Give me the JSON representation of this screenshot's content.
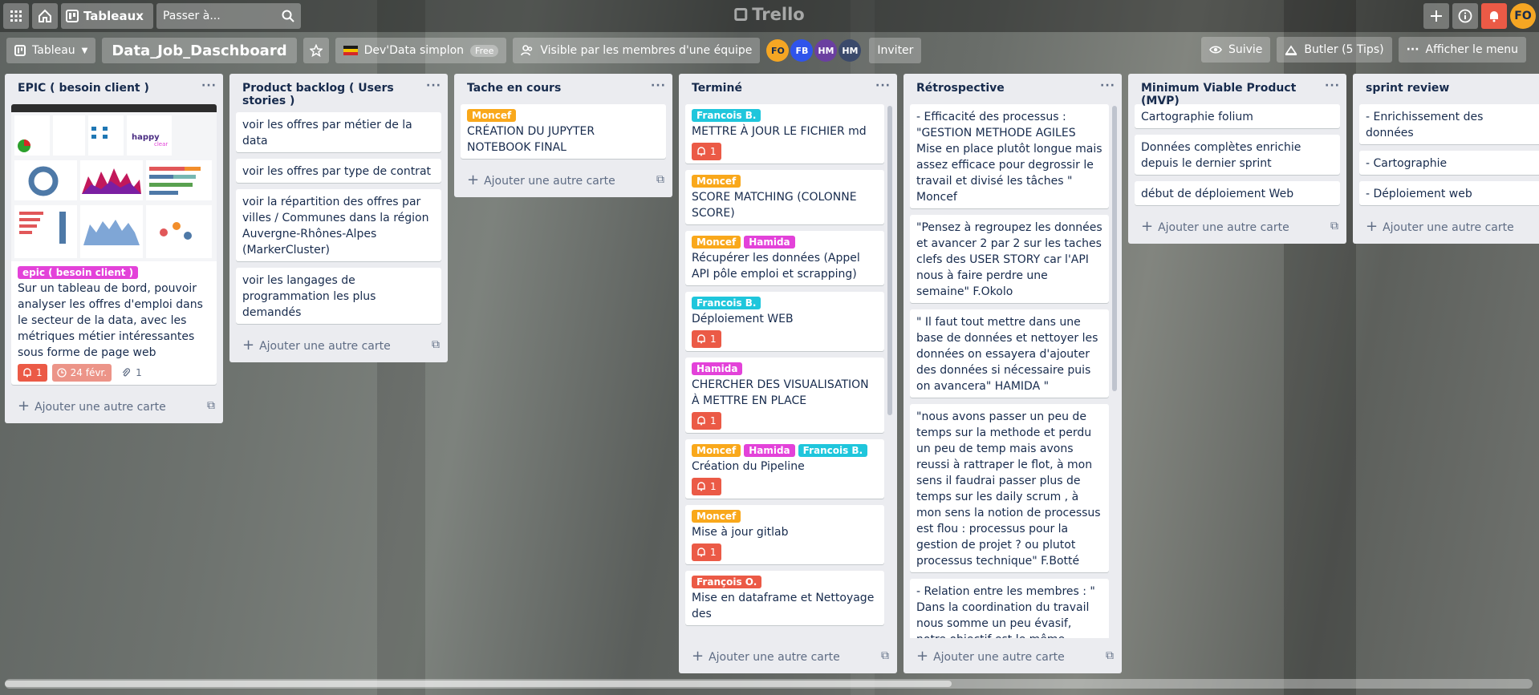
{
  "header": {
    "boards_label": "Tableaux",
    "search_placeholder": "Passer à...",
    "logo": "Trello",
    "user_initials": "FO"
  },
  "board": {
    "view_label": "Tableau",
    "title": "Data_Job_Daschboard",
    "team": "Dev'Data simplon",
    "team_plan": "Free",
    "visibility": "Visible par les membres d'une équipe",
    "members": [
      {
        "initials": "FO",
        "color": "#f5a623"
      },
      {
        "initials": "FB",
        "color": "#2f54eb"
      },
      {
        "initials": "HM",
        "color": "#6b3fa0"
      },
      {
        "initials": "HM",
        "color": "#3b4a6b"
      }
    ],
    "invite": "Inviter",
    "watch": "Suivie",
    "butler": "Butler (5 Tips)",
    "menu": "Afficher le menu"
  },
  "colors": {
    "label_pink": "#e342d9",
    "label_orange": "#f9a81b",
    "label_cyan": "#1fc6dc",
    "label_red": "#eb5a46",
    "badge_red": "#eb5a46"
  },
  "add_card": "Ajouter une autre carte",
  "lists": [
    {
      "title": "EPIC ( besoin client )",
      "cards": [
        {
          "labels": [
            {
              "text": "epic ( besoin client )",
              "color": "#e342d9"
            }
          ],
          "text": "Sur un tableau de bord, pouvoir analyser les offres d'emploi dans le secteur de la data, avec les métriques métier intéressantes sous forme de page web",
          "notif": "1",
          "date": "24 févr.",
          "attach": "1"
        }
      ]
    },
    {
      "title": "Product backlog ( Users stories )",
      "cards": [
        {
          "text": "voir les offres par métier de la data"
        },
        {
          "text": "voir les offres par type de contrat"
        },
        {
          "text": "voir la répartition des offres par villes / Communes dans la région Auvergne-Rhônes-Alpes (MarkerCluster)"
        },
        {
          "text": "voir les langages de programmation les plus demandés"
        }
      ]
    },
    {
      "title": "Tache en cours",
      "cards": [
        {
          "labels": [
            {
              "text": "Moncef",
              "color": "#f9a81b"
            }
          ],
          "text": "CRÉATION DU JUPYTER NOTEBOOK FINAL"
        }
      ]
    },
    {
      "title": "Terminé",
      "cards": [
        {
          "labels": [
            {
              "text": "Francois B.",
              "color": "#1fc6dc"
            }
          ],
          "text": "METTRE À JOUR LE FICHIER md",
          "notif": "1"
        },
        {
          "labels": [
            {
              "text": "Moncef",
              "color": "#f9a81b"
            }
          ],
          "text": "SCORE MATCHING (COLONNE SCORE)"
        },
        {
          "labels": [
            {
              "text": "Moncef",
              "color": "#f9a81b"
            },
            {
              "text": "Hamida",
              "color": "#e342d9"
            }
          ],
          "text": "Récupérer les données (Appel API pôle emploi et scrapping)"
        },
        {
          "labels": [
            {
              "text": "Francois B.",
              "color": "#1fc6dc"
            }
          ],
          "text": "Déploiement WEB",
          "notif": "1"
        },
        {
          "labels": [
            {
              "text": "Hamida",
              "color": "#e342d9"
            }
          ],
          "text": "CHERCHER DES VISUALISATION À METTRE EN PLACE",
          "notif": "1"
        },
        {
          "labels": [
            {
              "text": "Moncef",
              "color": "#f9a81b"
            },
            {
              "text": "Hamida",
              "color": "#e342d9"
            },
            {
              "text": "Francois B.",
              "color": "#1fc6dc"
            }
          ],
          "text": "Création du Pipeline",
          "notif": "1"
        },
        {
          "labels": [
            {
              "text": "Moncef",
              "color": "#f9a81b"
            }
          ],
          "text": "Mise à jour gitlab",
          "notif": "1"
        },
        {
          "labels": [
            {
              "text": "François O.",
              "color": "#eb5a46"
            }
          ],
          "text": "Mise en dataframe et Nettoyage des"
        }
      ]
    },
    {
      "title": "Rétrospective",
      "cards": [
        {
          "text": "- Efficacité des processus : \"GESTION METHODE AGILES Mise en place plutôt longue mais assez efficace pour degrossir le travail et divisé les tâches \" Moncef"
        },
        {
          "text": "\"Pensez à regroupez les données et avancer 2 par 2 sur les taches clefs des USER STORY car l'API nous à faire perdre une semaine\" F.Okolo"
        },
        {
          "text": "\" Il faut tout mettre dans une base de données et nettoyer les données on essayera d'ajouter des données si nécessaire puis on avancera\" HAMIDA \""
        },
        {
          "text": "\"nous avons passer un peu de temps sur la methode et perdu un peu de temp mais avons reussi à rattraper le flot, à mon sens il faudrai passer plus de temps sur les daily scrum , à mon sens la notion de processus est flou : processus pour la gestion de projet ? ou plutot processus technique\" F.Botté"
        },
        {
          "text": "- Relation entre les membres : \" Dans la coordination du travail nous somme un peu évasif, notre objectif est le même malgrès que les outils sont différents, et manque de communication en interne donc cela"
        }
      ]
    },
    {
      "title": "Minimum Viable Product (MVP)",
      "cards": [
        {
          "text": "Cartographie folium"
        },
        {
          "text": "Données complètes enrichie depuis le dernier sprint"
        },
        {
          "text": "début de déploiement Web"
        }
      ]
    },
    {
      "title": "sprint review",
      "cards": [
        {
          "text": "- Enrichissement des données"
        },
        {
          "text": "- Cartographie"
        },
        {
          "text": "- Déploiement web"
        }
      ]
    }
  ]
}
